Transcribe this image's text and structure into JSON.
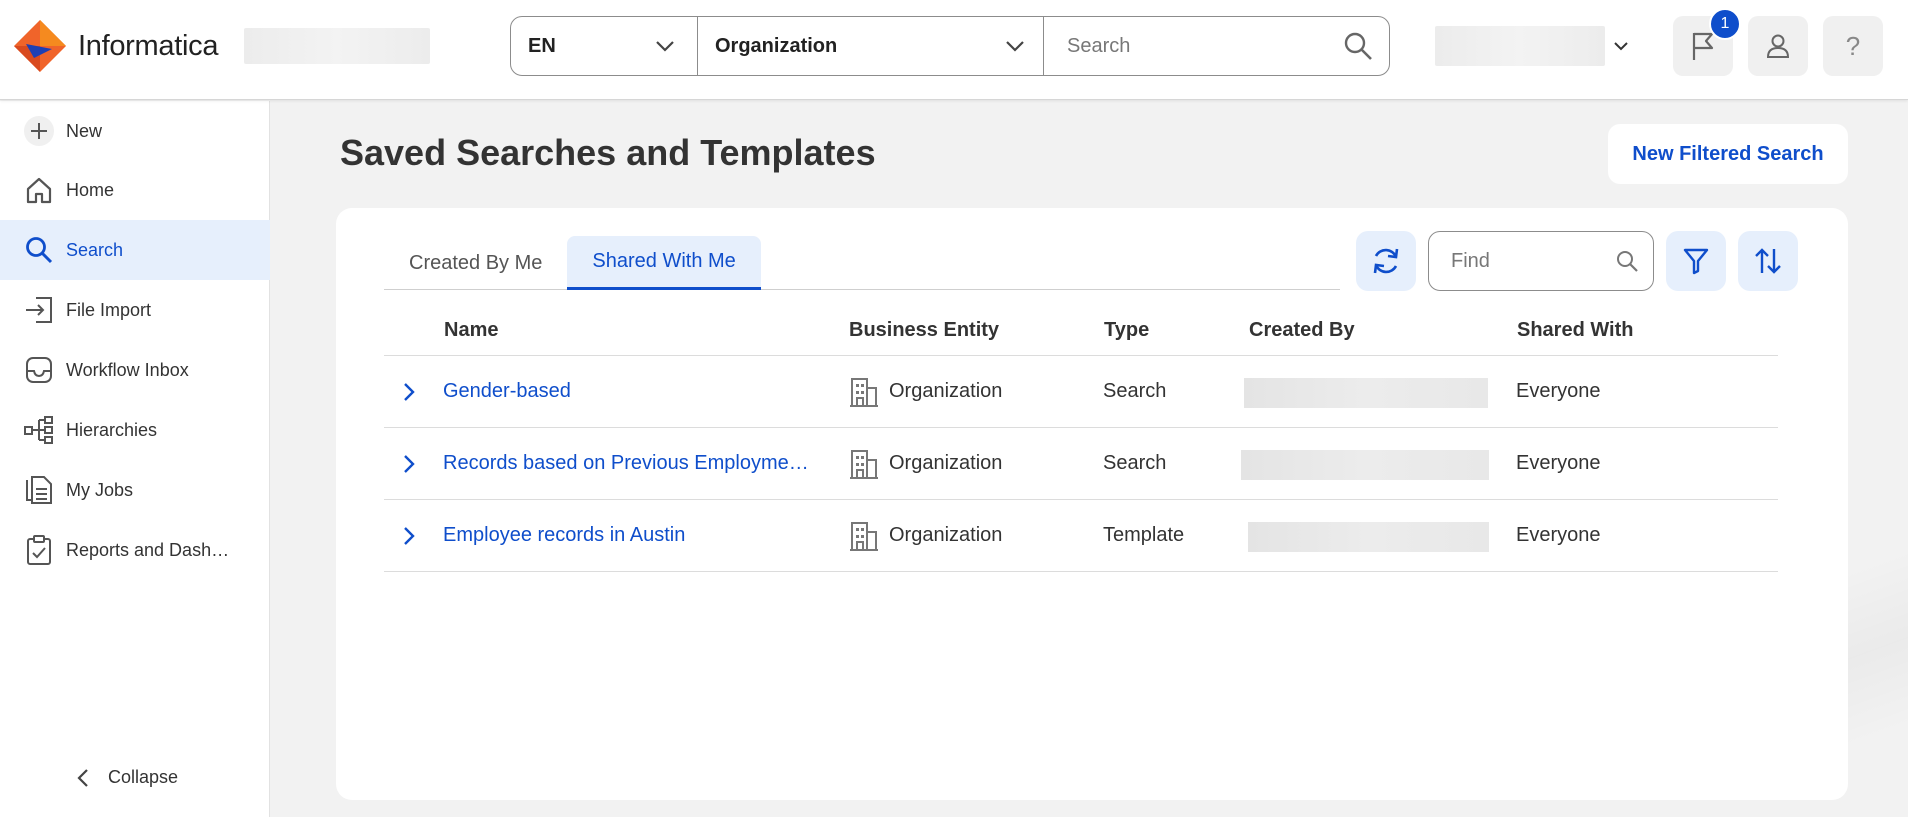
{
  "header": {
    "logo_text": "Informatica",
    "language": "EN",
    "scope": "Organization",
    "search_placeholder": "Search",
    "notification_count": "1"
  },
  "sidebar": {
    "new_label": "New",
    "items": [
      {
        "label": "Home",
        "icon": "home-icon"
      },
      {
        "label": "Search",
        "icon": "search-icon"
      },
      {
        "label": "File Import",
        "icon": "file-import-icon"
      },
      {
        "label": "Workflow Inbox",
        "icon": "inbox-icon"
      },
      {
        "label": "Hierarchies",
        "icon": "hierarchy-icon"
      },
      {
        "label": "My Jobs",
        "icon": "jobs-icon"
      },
      {
        "label": "Reports and Dash…",
        "icon": "reports-icon"
      }
    ],
    "active_item": "Search",
    "collapse_label": "Collapse"
  },
  "main": {
    "title": "Saved Searches and Templates",
    "new_filtered_search_label": "New Filtered Search",
    "tabs": [
      {
        "label": "Created By Me",
        "active": false
      },
      {
        "label": "Shared With Me",
        "active": true
      }
    ],
    "find_placeholder": "Find",
    "table": {
      "columns": [
        "Name",
        "Business Entity",
        "Type",
        "Created By",
        "Shared With"
      ],
      "rows": [
        {
          "name": "Gender-based",
          "entity": "Organization",
          "type": "Search",
          "shared_with": "Everyone"
        },
        {
          "name": "Records based on Previous Employme…",
          "entity": "Organization",
          "type": "Search",
          "shared_with": "Everyone"
        },
        {
          "name": "Employee records in Austin",
          "entity": "Organization",
          "type": "Template",
          "shared_with": "Everyone"
        }
      ]
    }
  },
  "colors": {
    "accent": "#0f4ecb",
    "active_bg": "#e6effc",
    "page_bg": "#f2f2f2"
  }
}
